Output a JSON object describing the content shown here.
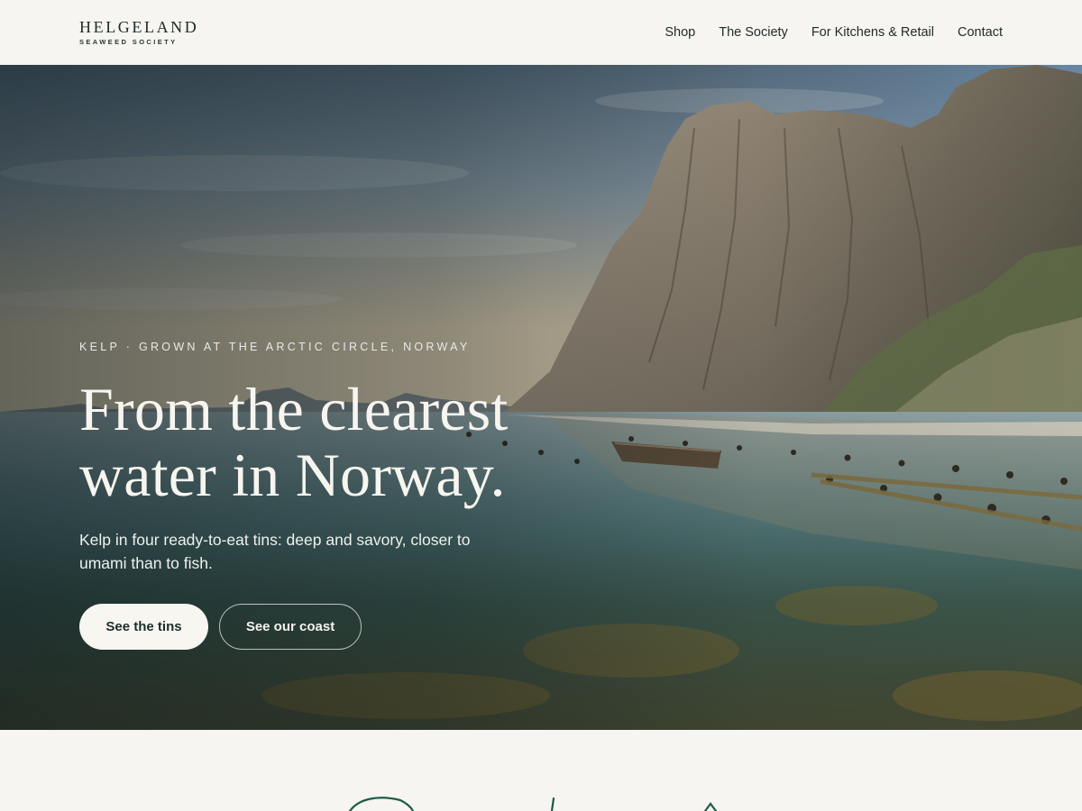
{
  "header": {
    "logo_main": "HELGELAND",
    "logo_sub": "SEAWEED SOCIETY",
    "nav": [
      {
        "label": "Shop"
      },
      {
        "label": "The Society"
      },
      {
        "label": "For Kitchens & Retail"
      },
      {
        "label": "Contact"
      }
    ]
  },
  "hero": {
    "eyebrow": "KELP · GROWN AT THE ARCTIC CIRCLE, NORWAY",
    "headline_line1": "From the clearest",
    "headline_line2": "water in Norway.",
    "lede": "Kelp in four ready-to-eat tins: deep and savory, closer to umami than to fish.",
    "primary_cta": "See the tins",
    "secondary_cta": "See our coast"
  },
  "colors": {
    "background": "#f6f5f1",
    "ink": "#1d2a26",
    "accent_green": "#1f5a4a"
  }
}
